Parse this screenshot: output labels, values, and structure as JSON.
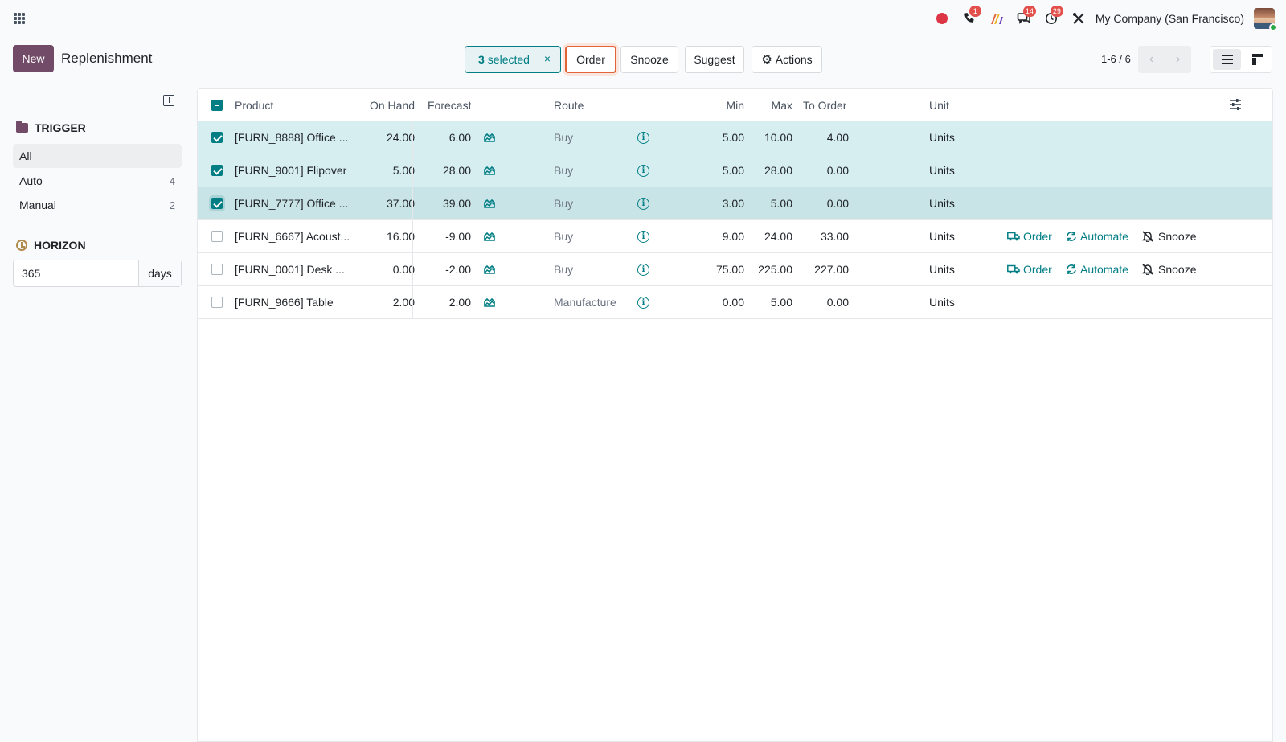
{
  "navbar": {
    "company": "My Company (San Francisco)",
    "badges": {
      "phone": "1",
      "messages": "14",
      "activities": "29"
    }
  },
  "control": {
    "new_label": "New",
    "title": "Replenishment",
    "selected_count": "3",
    "selected_text": "selected",
    "clear_label": "×",
    "order_label": "Order",
    "snooze_label": "Snooze",
    "suggest_label": "Suggest",
    "actions_label": "Actions",
    "pager": "1-6 / 6"
  },
  "sidebar": {
    "trigger_title": "TRIGGER",
    "trigger_items": [
      {
        "label": "All",
        "count": ""
      },
      {
        "label": "Auto",
        "count": "4"
      },
      {
        "label": "Manual",
        "count": "2"
      }
    ],
    "horizon_title": "HORIZON",
    "horizon_value": "365",
    "horizon_unit": "days"
  },
  "table": {
    "headers": {
      "product": "Product",
      "on_hand": "On Hand",
      "forecast": "Forecast",
      "route": "Route",
      "min": "Min",
      "max": "Max",
      "to_order": "To Order",
      "unit": "Unit"
    },
    "row_actions": {
      "order": "Order",
      "automate": "Automate",
      "snooze": "Snooze"
    },
    "rows": [
      {
        "product": "[FURN_8888] Office ...",
        "on_hand": "24.00",
        "forecast": "6.00",
        "route": "Buy",
        "min": "5.00",
        "max": "10.00",
        "to_order": "4.00",
        "unit": "Units",
        "selected": true
      },
      {
        "product": "[FURN_9001] Flipover",
        "on_hand": "5.00",
        "forecast": "28.00",
        "route": "Buy",
        "min": "5.00",
        "max": "28.00",
        "to_order": "0.00",
        "unit": "Units",
        "selected": true
      },
      {
        "product": "[FURN_7777] Office ...",
        "on_hand": "37.00",
        "forecast": "39.00",
        "route": "Buy",
        "min": "3.00",
        "max": "5.00",
        "to_order": "0.00",
        "unit": "Units",
        "selected": true
      },
      {
        "product": "[FURN_6667] Acoust...",
        "on_hand": "16.00",
        "forecast": "-9.00",
        "route": "Buy",
        "min": "9.00",
        "max": "24.00",
        "to_order": "33.00",
        "unit": "Units",
        "selected": false
      },
      {
        "product": "[FURN_0001] Desk ...",
        "on_hand": "0.00",
        "forecast": "-2.00",
        "route": "Buy",
        "min": "75.00",
        "max": "225.00",
        "to_order": "227.00",
        "unit": "Units",
        "selected": false
      },
      {
        "product": "[FURN_9666] Table",
        "on_hand": "2.00",
        "forecast": "2.00",
        "route": "Manufacture",
        "min": "0.00",
        "max": "5.00",
        "to_order": "0.00",
        "unit": "Units",
        "selected": false
      }
    ]
  },
  "colors": {
    "brand": "#714b67",
    "accent": "#017e84",
    "focus_ring": "#e0633a",
    "selected_row": "#d6eef0"
  }
}
